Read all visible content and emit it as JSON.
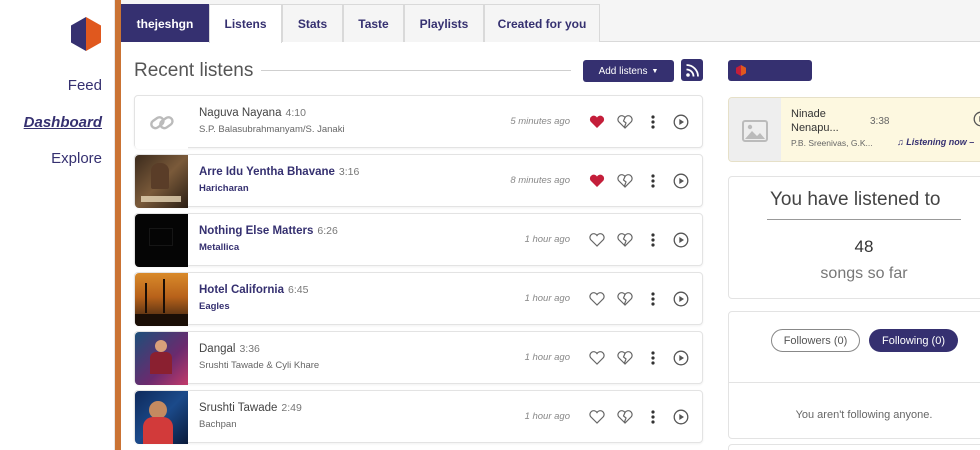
{
  "sidebar": {
    "logo_icon": "listenbrainz-logo",
    "items": [
      {
        "label": "Feed"
      },
      {
        "label": "Dashboard"
      },
      {
        "label": "Explore"
      }
    ]
  },
  "tabs": [
    {
      "label": "thejeshgn"
    },
    {
      "label": "Listens"
    },
    {
      "label": "Stats"
    },
    {
      "label": "Taste"
    },
    {
      "label": "Playlists"
    },
    {
      "label": "Created for you"
    }
  ],
  "main": {
    "title": "Recent listens",
    "add_listens_label": "Add listens",
    "rss_icon": "rss-icon"
  },
  "listens": [
    {
      "track": "Naguva Nayana",
      "duration": "4:10",
      "artist": "S.P. Balasubrahmanyam/S. Janaki",
      "time": "5 minutes ago",
      "loved": true,
      "linked": false,
      "cover": "link-icon"
    },
    {
      "track": "Arre Idu Yentha Bhavane",
      "duration": "3:16",
      "artist": "Haricharan",
      "time": "8 minutes ago",
      "loved": true,
      "linked": true,
      "cover": "album-art"
    },
    {
      "track": "Nothing Else Matters",
      "duration": "6:26",
      "artist": "Metallica",
      "time": "1 hour ago",
      "loved": false,
      "linked": true,
      "cover": "album-art"
    },
    {
      "track": "Hotel California",
      "duration": "6:45",
      "artist": "Eagles",
      "time": "1 hour ago",
      "loved": false,
      "linked": true,
      "cover": "album-art"
    },
    {
      "track": "Dangal",
      "duration": "3:36",
      "artist": "Srushti Tawade & Cyli Khare",
      "time": "1 hour ago",
      "loved": false,
      "linked": false,
      "cover": "album-art"
    },
    {
      "track": "Srushti Tawade",
      "duration": "2:49",
      "artist": "Bachpan",
      "time": "1 hour ago",
      "loved": false,
      "linked": false,
      "cover": "album-art"
    }
  ],
  "now_playing": {
    "track": "Ninade Nenapu...",
    "duration": "3:38",
    "artist": "P.B. Sreenivas, G.K...",
    "status": "Listening now –"
  },
  "stats": {
    "heading": "You have listened to",
    "count": "48",
    "caption": "songs so far"
  },
  "follow": {
    "followers_label": "Followers (0)",
    "following_label": "Following (0)",
    "empty_message": "You aren't following anyone."
  },
  "colors": {
    "brand": "#353070",
    "accent": "#e0581e",
    "loved": "#c41e3a"
  }
}
